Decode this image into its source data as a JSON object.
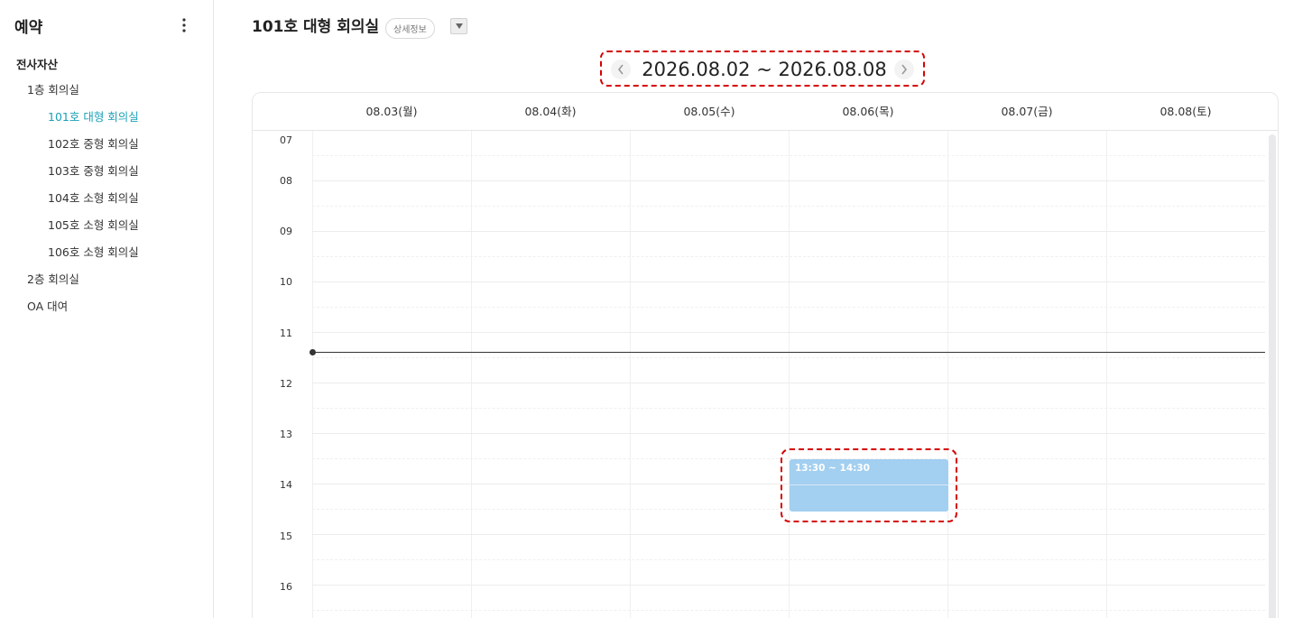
{
  "sidebar": {
    "title": "예약",
    "more_icon": "more-vertical-icon",
    "tree": {
      "root": "전사자산",
      "floor1": "1층 회의실",
      "rooms": [
        "101호 대형 회의실",
        "102호 중형 회의실",
        "103호 중형 회의실",
        "104호 소형 회의실",
        "105호 소형 회의실",
        "106호 소형 회의실"
      ],
      "floor2": "2층 회의실",
      "oa": "OA 대여"
    },
    "active_color": "#1aa0b8"
  },
  "main": {
    "title": "101호 대형 회의실",
    "detail_label": "상세정보",
    "date_range": "2026.08.02 ~ 2026.08.08",
    "days": [
      "08.03(월)",
      "08.04(화)",
      "08.05(수)",
      "08.06(목)",
      "08.07(금)",
      "08.08(토)"
    ],
    "hours": [
      "07",
      "08",
      "09",
      "10",
      "11",
      "12",
      "13",
      "14",
      "15",
      "16"
    ],
    "event": {
      "time": "13:30 ~ 14:30",
      "color": "#a3cff0"
    },
    "highlight_color": "#d40000"
  }
}
